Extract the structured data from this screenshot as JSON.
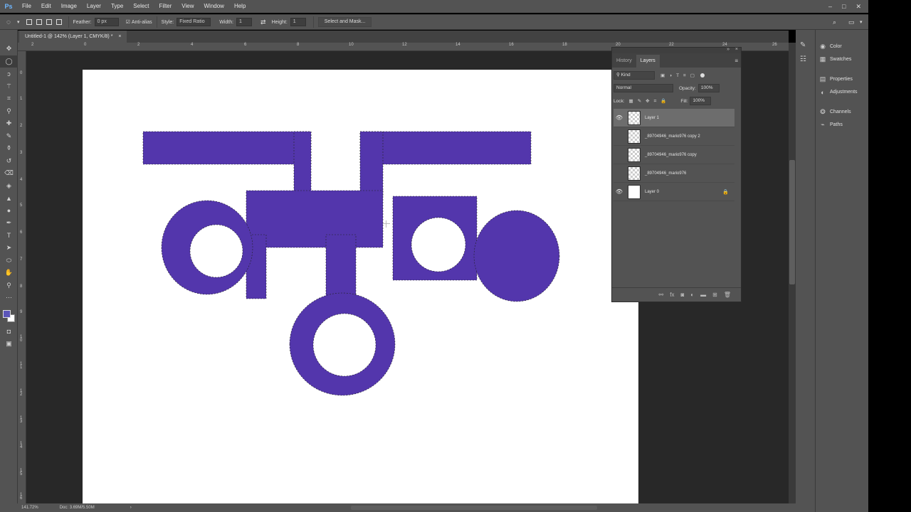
{
  "app": {
    "logo": "Ps"
  },
  "menu": [
    "File",
    "Edit",
    "Image",
    "Layer",
    "Type",
    "Select",
    "Filter",
    "View",
    "Window",
    "Help"
  ],
  "window_controls": [
    "–",
    "□",
    "✕"
  ],
  "options": {
    "feather_label": "Feather:",
    "feather_value": "0 px",
    "antialias_label": "Anti-alias",
    "style_label": "Style:",
    "style_value": "Fixed Ratio",
    "width_label": "Width:",
    "width_value": "1",
    "height_label": "Height:",
    "height_value": "1",
    "select_mask": "Select and Mask..."
  },
  "doc_tab": {
    "title": "Untitled-1 @ 142% (Layer 1, CMYK/8) *",
    "close": "×"
  },
  "ruler_top_labels": [
    "2",
    "0",
    "2",
    "4",
    "6",
    "8",
    "10",
    "12",
    "14",
    "16",
    "18",
    "20",
    "22",
    "24",
    "26"
  ],
  "ruler_left_labels": [
    "0",
    "1",
    "2",
    "3",
    "4",
    "5",
    "6",
    "7",
    "8",
    "9",
    "1 0",
    "1 1",
    "1 2",
    "1 3",
    "1 4",
    "1 5",
    "1 6"
  ],
  "status": {
    "zoom": "141.72%",
    "doc": "Doc: 3.69M/5.50M",
    "arrow": "›"
  },
  "layers_panel": {
    "tab_history": "History",
    "tab_layers": "Layers",
    "kind_filter": "Kind",
    "blend_mode": "Normal",
    "opacity_label": "Opacity:",
    "opacity_value": "100%",
    "lock_label": "Lock:",
    "fill_label": "Fill:",
    "fill_value": "100%",
    "layers": [
      {
        "name": "Layer 1",
        "visible": true,
        "selected": true
      },
      {
        "name": "_89704946_mario976 copy 2",
        "visible": false,
        "selected": false
      },
      {
        "name": "_89704946_mario976 copy",
        "visible": false,
        "selected": false
      },
      {
        "name": "_89704946_mario976",
        "visible": false,
        "selected": false
      },
      {
        "name": "Layer 0",
        "visible": true,
        "selected": false,
        "locked": true
      }
    ]
  },
  "dock": {
    "group1": [
      "Color",
      "Swatches"
    ],
    "group2": [
      "Properties",
      "Adjustments"
    ],
    "group3": [
      "Channels",
      "Paths"
    ]
  },
  "colors": {
    "shape_fill": "#5336ac",
    "canvas": "#ffffff",
    "pasteboard": "#282828",
    "ui_bg": "#535353",
    "foreground": "#5b55b8",
    "background": "#ffffff"
  }
}
